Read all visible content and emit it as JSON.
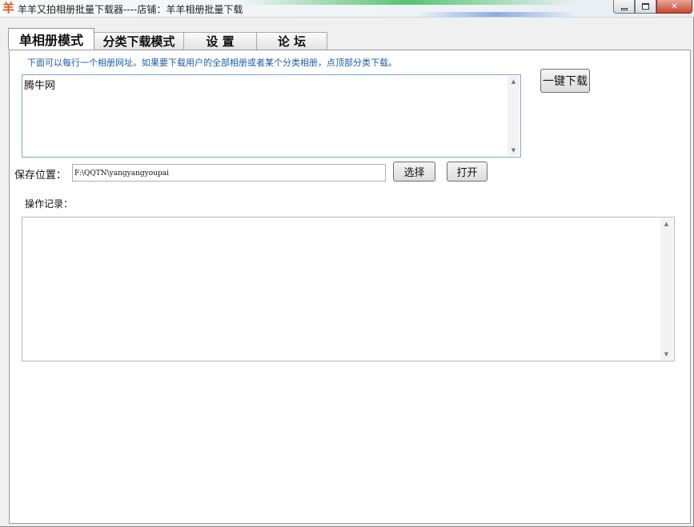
{
  "window": {
    "icon_char": "羊",
    "title": "羊羊又拍相册批量下载器----店铺：羊羊相册批量下载",
    "controls": {
      "minimize": "minimize",
      "maximize": "maximize",
      "close": "✕"
    }
  },
  "tabs": [
    {
      "label": "单相册模式",
      "active": true
    },
    {
      "label": "分类下载模式",
      "active": false
    },
    {
      "label": "设  置",
      "active": false
    },
    {
      "label": "论  坛",
      "active": false
    }
  ],
  "single_album": {
    "hint": "下面可以每行一个相册网址。如果要下载用户的全部相册或者某个分类相册，点顶部分类下载。",
    "urls_text": "腾牛网",
    "download_button": "一键下载",
    "save_label": "保存位置：",
    "save_path": "F:\\QQTN\\yangyangyoupai",
    "choose_button": "选择",
    "open_button": "打开",
    "log_label": "操作记录：",
    "log_text": ""
  },
  "colors": {
    "hint_text": "#1a5fa8",
    "accent_icon": "#e0561b"
  },
  "icons": {
    "scroll_up": "▲",
    "scroll_down": "▼"
  }
}
